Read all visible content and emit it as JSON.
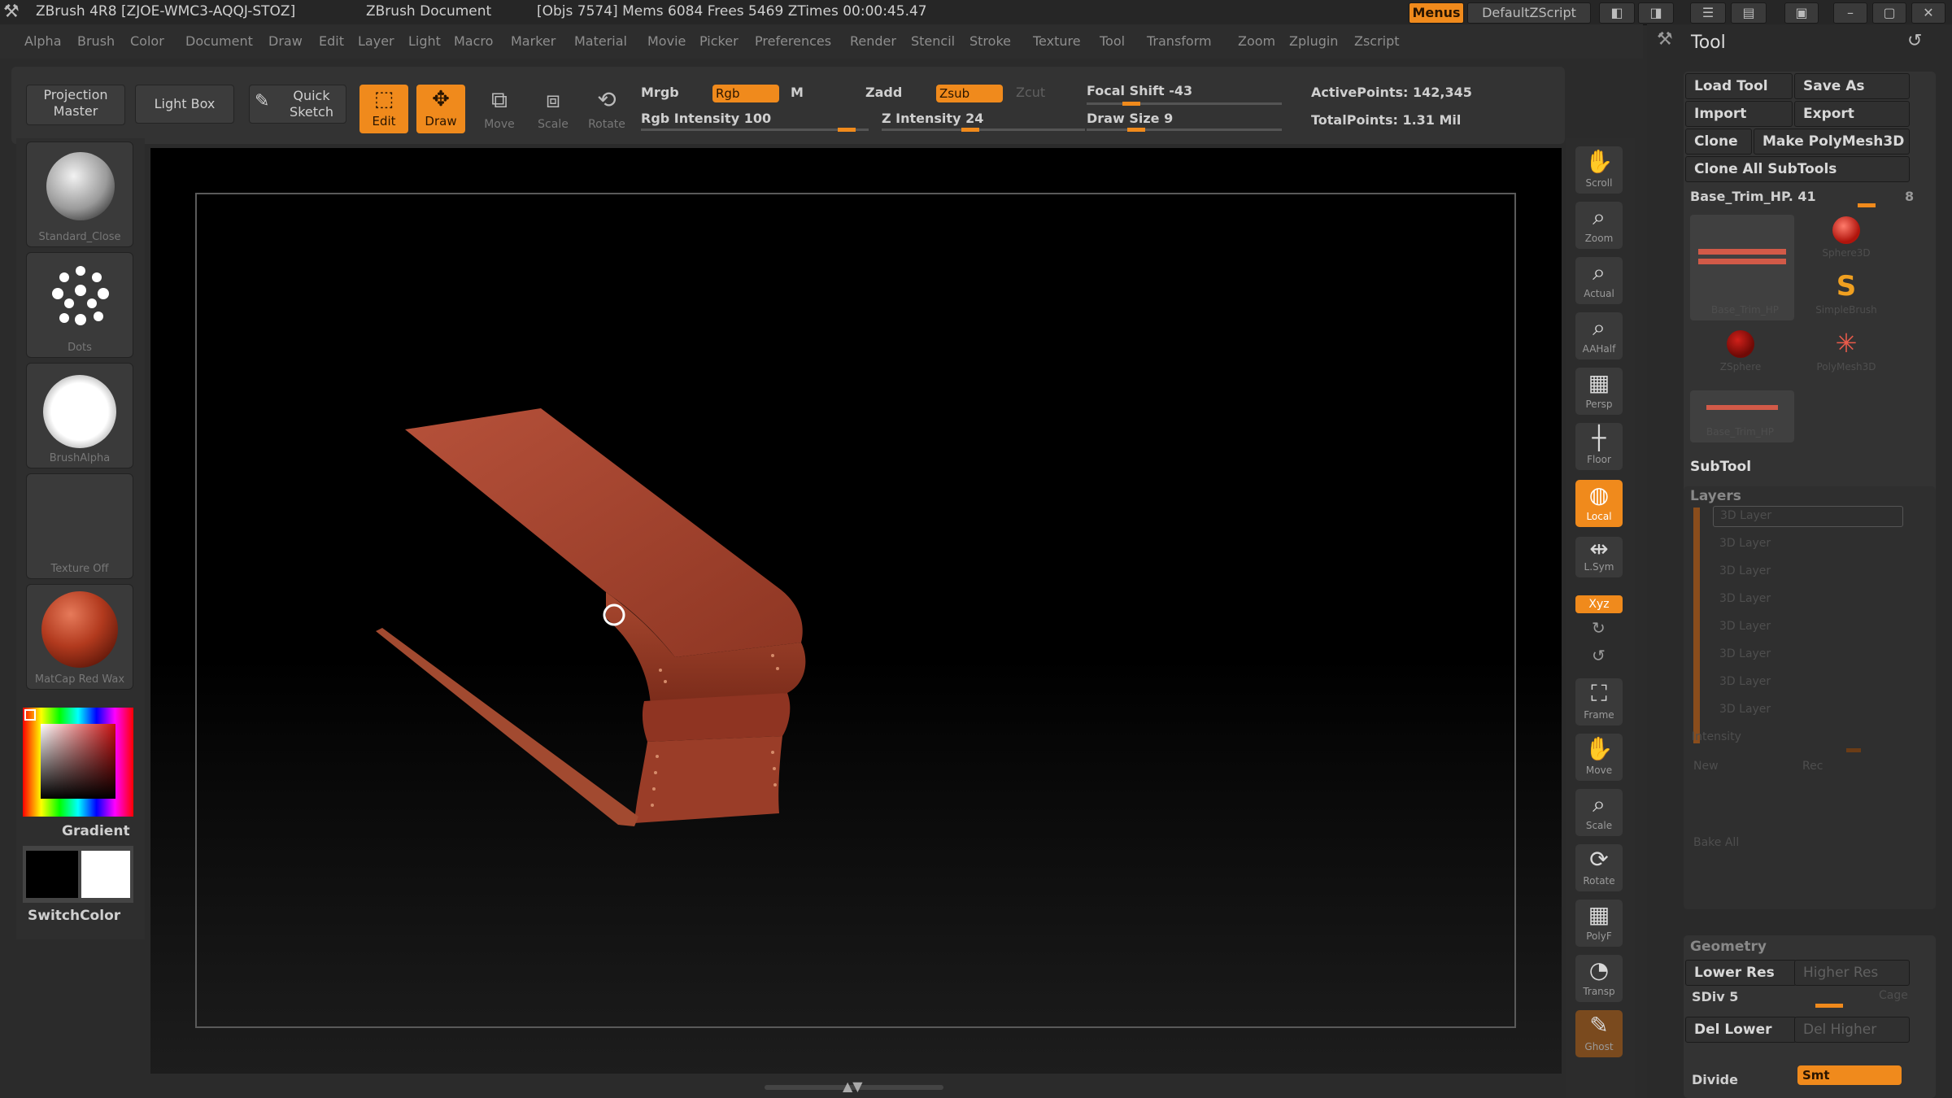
{
  "titlebar": {
    "app": "ZBrush 4R8 [ZJOE-WMC3-AQQJ-STOZ]",
    "document": "ZBrush Document",
    "stats": "[Objs 7574] Mems 6084  Frees 5469  ZTimes 00:00:45.47",
    "menus_btn": "Menus",
    "script_btn": "DefaultZScript"
  },
  "menubar": [
    "Alpha",
    "Brush",
    "Color",
    "Document",
    "Draw",
    "Edit",
    "Layer",
    "Light",
    "Macro",
    "Marker",
    "Material",
    "Movie",
    "Picker",
    "Preferences",
    "Render",
    "Stencil",
    "Stroke",
    "Texture",
    "Tool",
    "Transform",
    "Zoom",
    "Zplugin",
    "Zscript"
  ],
  "shelf": {
    "projection_master": "Projection Master",
    "lightbox": "Light Box",
    "quick_sketch": "Quick Sketch",
    "edit": "Edit",
    "draw": "Draw",
    "move": "Move",
    "scale": "Scale",
    "rotate": "Rotate",
    "mrgb": "Mrgb",
    "rgb": "Rgb",
    "m": "M",
    "rgb_intensity": "Rgb Intensity 100",
    "zadd": "Zadd",
    "zsub": "Zsub",
    "zcut": "Zcut",
    "z_intensity": "Z Intensity 24",
    "focal_shift": "Focal Shift -43",
    "draw_size": "Draw Size 9",
    "active_points": "ActivePoints: 142,345",
    "total_points": "TotalPoints: 1.31 Mil"
  },
  "leftshelf": {
    "brush_caption": "Standard_Close",
    "stroke_caption": "Dots",
    "alpha_caption": "BrushAlpha",
    "texture_caption": "Texture Off",
    "material_caption": "MatCap Red Wax",
    "gradient_label": "Gradient",
    "switchcolor_label": "SwitchColor"
  },
  "rightshelf": [
    "Scroll",
    "Zoom",
    "Actual",
    "AAHalf",
    "Persp",
    "Floor",
    "Local",
    "L.Sym",
    "Xyz",
    "Frame",
    "Move",
    "Scale",
    "Rotate",
    "PolyF",
    "Transp",
    "Ghost"
  ],
  "toolpanel": {
    "title": "Tool",
    "load_tool": "Load Tool",
    "save_as": "Save As",
    "import": "Import",
    "export": "Export",
    "clone": "Clone",
    "make_polymesh": "Make PolyMesh3D",
    "clone_all": "Clone All SubTools",
    "current_tool": "Base_Trim_HP. 41",
    "current_tool_value": "8",
    "tool_thumbs": [
      "Base_Trim_HP",
      "Sphere3D",
      "SimpleBrush",
      "ZSphere",
      "PolyMesh3D",
      "Base_Trim_HP"
    ],
    "subtool": "SubTool",
    "layers": "Layers",
    "layer_items": [
      "3D Layer",
      "3D Layer",
      "3D Layer",
      "3D Layer",
      "3D Layer",
      "3D Layer",
      "3D Layer",
      "3D Layer"
    ],
    "intensity": "Intensity",
    "new": "New",
    "rec": "Rec",
    "bake_all": "Bake All",
    "geometry": "Geometry",
    "lower_res": "Lower Res",
    "higher_res": "Higher Res",
    "sdiv": "SDiv 5",
    "cage": "Cage",
    "del_lower": "Del Lower",
    "del_higher": "Del Higher",
    "divide": "Divide",
    "smt": "Smt"
  }
}
